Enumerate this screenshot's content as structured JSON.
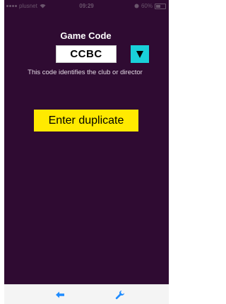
{
  "status_bar": {
    "carrier": "plusnet",
    "time": "09:29",
    "battery": "60%"
  },
  "game_code": {
    "label": "Game Code",
    "value": "CCBC",
    "help": "This code identifies the club or director"
  },
  "actions": {
    "enter_duplicate": "Enter duplicate"
  },
  "colors": {
    "background": "#2f0b32",
    "accent_button": "#ffea00",
    "dropdown": "#19d0d9",
    "toolbar_icons": "#1f8cff"
  },
  "toolbar": {
    "icons": [
      "back-arrow-icon",
      "wrench-icon"
    ]
  }
}
